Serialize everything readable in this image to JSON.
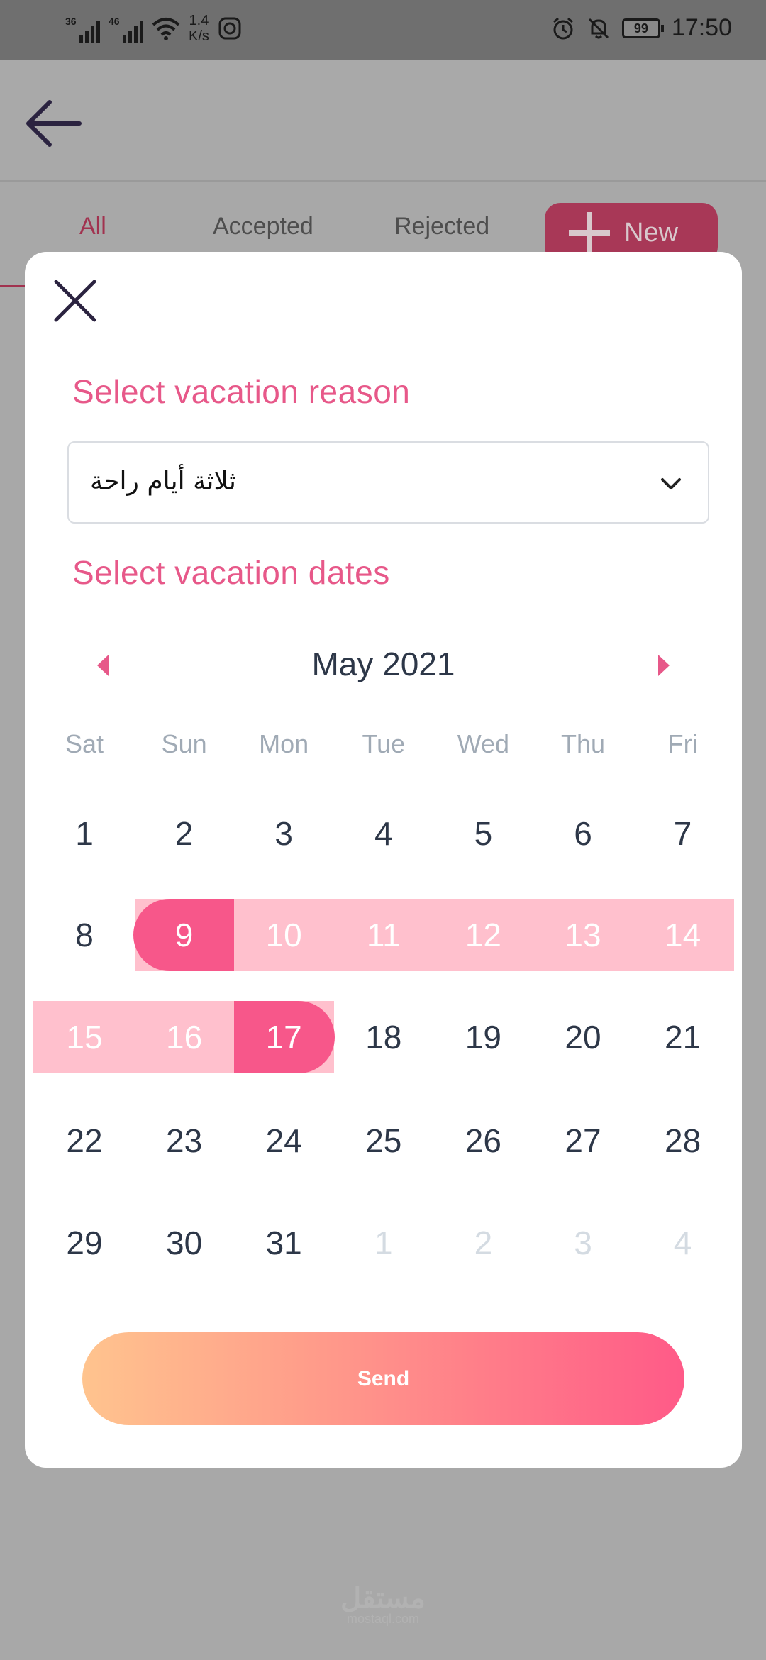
{
  "status_bar": {
    "sim1": "36",
    "sim2": "46",
    "speed_value": "1.4",
    "speed_unit": "K/s",
    "battery": "99",
    "time": "17:50",
    "icons": [
      "signal-icon",
      "wifi-icon",
      "nfc-icon",
      "alarm-icon",
      "mute-icon",
      "battery-icon"
    ]
  },
  "header": {
    "back_icon": "arrow-left-icon"
  },
  "tabs": [
    {
      "label": "All",
      "active": true
    },
    {
      "label": "Accepted",
      "active": false
    },
    {
      "label": "Rejected",
      "active": false
    }
  ],
  "new_button": {
    "label": "New",
    "icon": "plus-icon"
  },
  "modal": {
    "close_icon": "close-icon",
    "reason_label": "Select vacation reason",
    "reason_value": "ثلاثة أيام راحة",
    "dates_label": "Select vacation dates",
    "month_title": "May 2021",
    "weekdays": [
      "Sat",
      "Sun",
      "Mon",
      "Tue",
      "Wed",
      "Thu",
      "Fri"
    ],
    "weeks": [
      [
        "1",
        "2",
        "3",
        "4",
        "5",
        "6",
        "7"
      ],
      [
        "8",
        "9",
        "10",
        "11",
        "12",
        "13",
        "14"
      ],
      [
        "15",
        "16",
        "17",
        "18",
        "19",
        "20",
        "21"
      ],
      [
        "22",
        "23",
        "24",
        "25",
        "26",
        "27",
        "28"
      ],
      [
        "29",
        "30",
        "31",
        "1",
        "2",
        "3",
        "4"
      ]
    ],
    "range_start": "9",
    "range_end": "17",
    "send_label": "Send"
  },
  "colors": {
    "accent": "#e75889",
    "range_fill": "#ffc0cd",
    "range_end": "#f7578a",
    "text_dark": "#2d3748"
  },
  "watermark": {
    "main": "مستقل",
    "sub": "mostaql.com"
  }
}
